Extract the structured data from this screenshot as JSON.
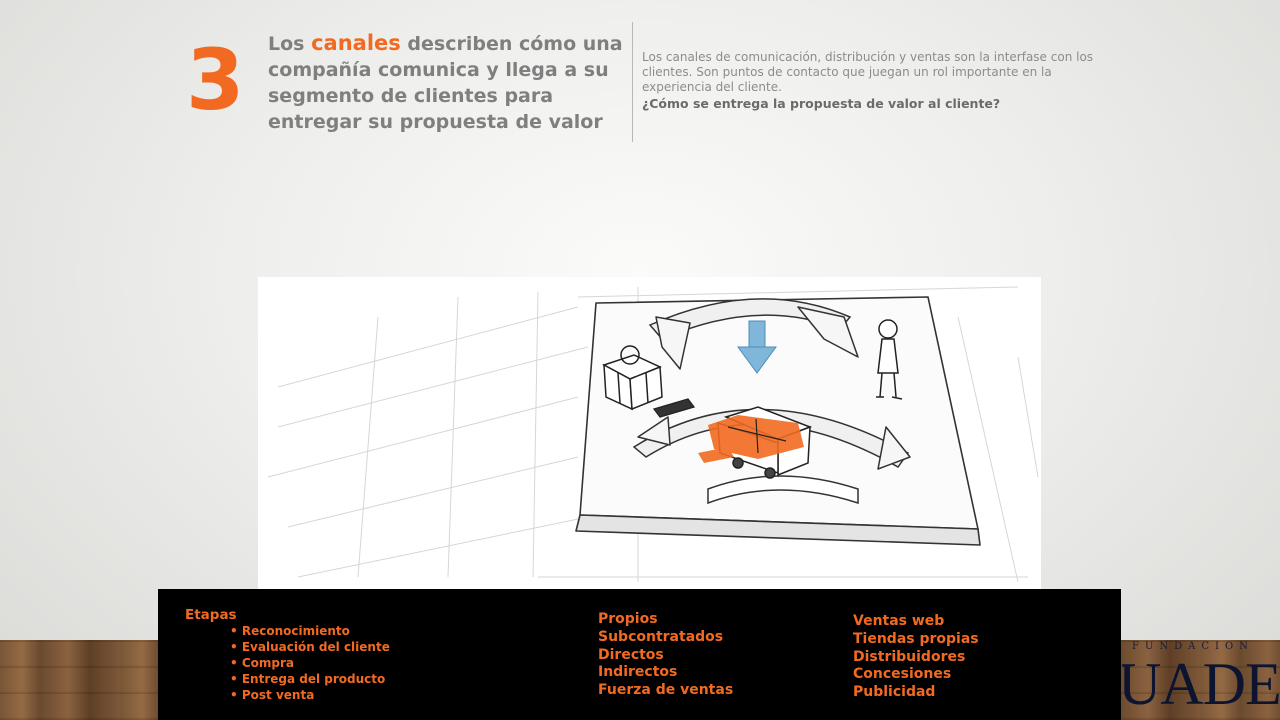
{
  "slide": {
    "number": "3",
    "heading": {
      "prefix": "Los ",
      "highlight": "canales",
      "rest": " describen cómo una compañía comunica y llega a su segmento de clientes para entregar su propuesta de valor"
    },
    "description": {
      "text": "Los canales de comunicación, distribución y ventas  son la interfase con los clientes. Son puntos de contacto que juegan un rol importante en la experiencia del cliente.",
      "question": "¿Cómo se entrega la propuesta de valor al cliente?"
    },
    "illustration": {
      "icon": "business-model-channels-sketch"
    },
    "info_box": {
      "stages_title": "Etapas",
      "stages": [
        "Reconocimiento",
        "Evaluación del cliente",
        "Compra",
        "Entrega del producto",
        "Post venta"
      ],
      "channel_types": [
        "Propios",
        "Subcontratados",
        "Directos",
        "Indirectos",
        "Fuerza de ventas"
      ],
      "channel_examples": [
        "Ventas web",
        "Tiendas propias",
        "Distribuidores",
        "Concesiones",
        "Publicidad"
      ]
    },
    "logo": {
      "small_text": "FUNDACION",
      "big_text": "UADE"
    },
    "colors": {
      "accent": "#f26a21",
      "heading_gray": "#7f7f7f",
      "box_background": "#000000"
    }
  }
}
